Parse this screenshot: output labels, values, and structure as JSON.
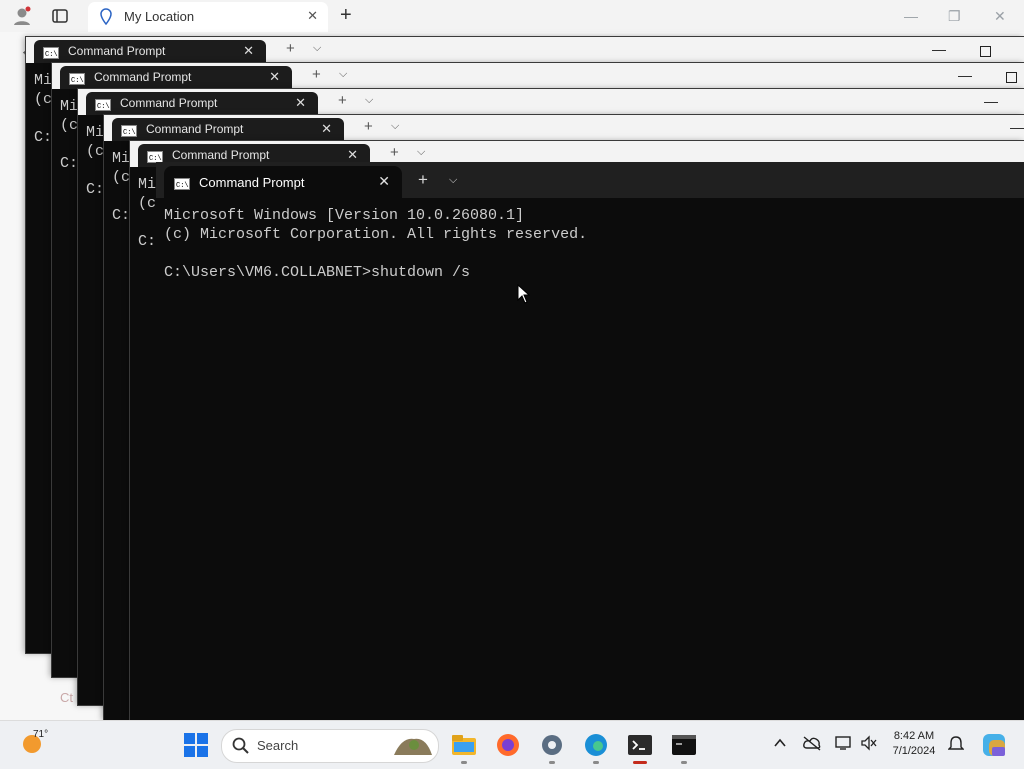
{
  "browser": {
    "tab_title": "My Location",
    "partial_page_text": "Ct"
  },
  "terminal": {
    "tab_label": "Command Prompt",
    "line1": "Microsoft Windows [Version 10.0.26080.1]",
    "line2": "(c) Microsoft Corporation. All rights reserved.",
    "prompt": "C:\\Users\\VM6.COLLABNET>shutdown /s",
    "bg_lines": [
      "Mi",
      "(c",
      "",
      "C:"
    ]
  },
  "taskbar": {
    "temperature": "71°",
    "search_placeholder": "Search",
    "time": "8:42 AM",
    "date": "7/1/2024",
    "icons": [
      "start-icon",
      "search-icon",
      "file-explorer-icon",
      "firefox-icon",
      "settings-icon",
      "edge-icon",
      "terminal-icon",
      "terminal-icon-2",
      "chevron-up-icon",
      "cloud-offline-icon",
      "display-icon",
      "volume-off-icon",
      "notification-bell-icon",
      "copilot-icon"
    ]
  },
  "colors": {
    "terminal_bg": "#0c0c0c",
    "taskbar_bg": "#eef0f3",
    "active_indicator": "#c42b1c"
  }
}
